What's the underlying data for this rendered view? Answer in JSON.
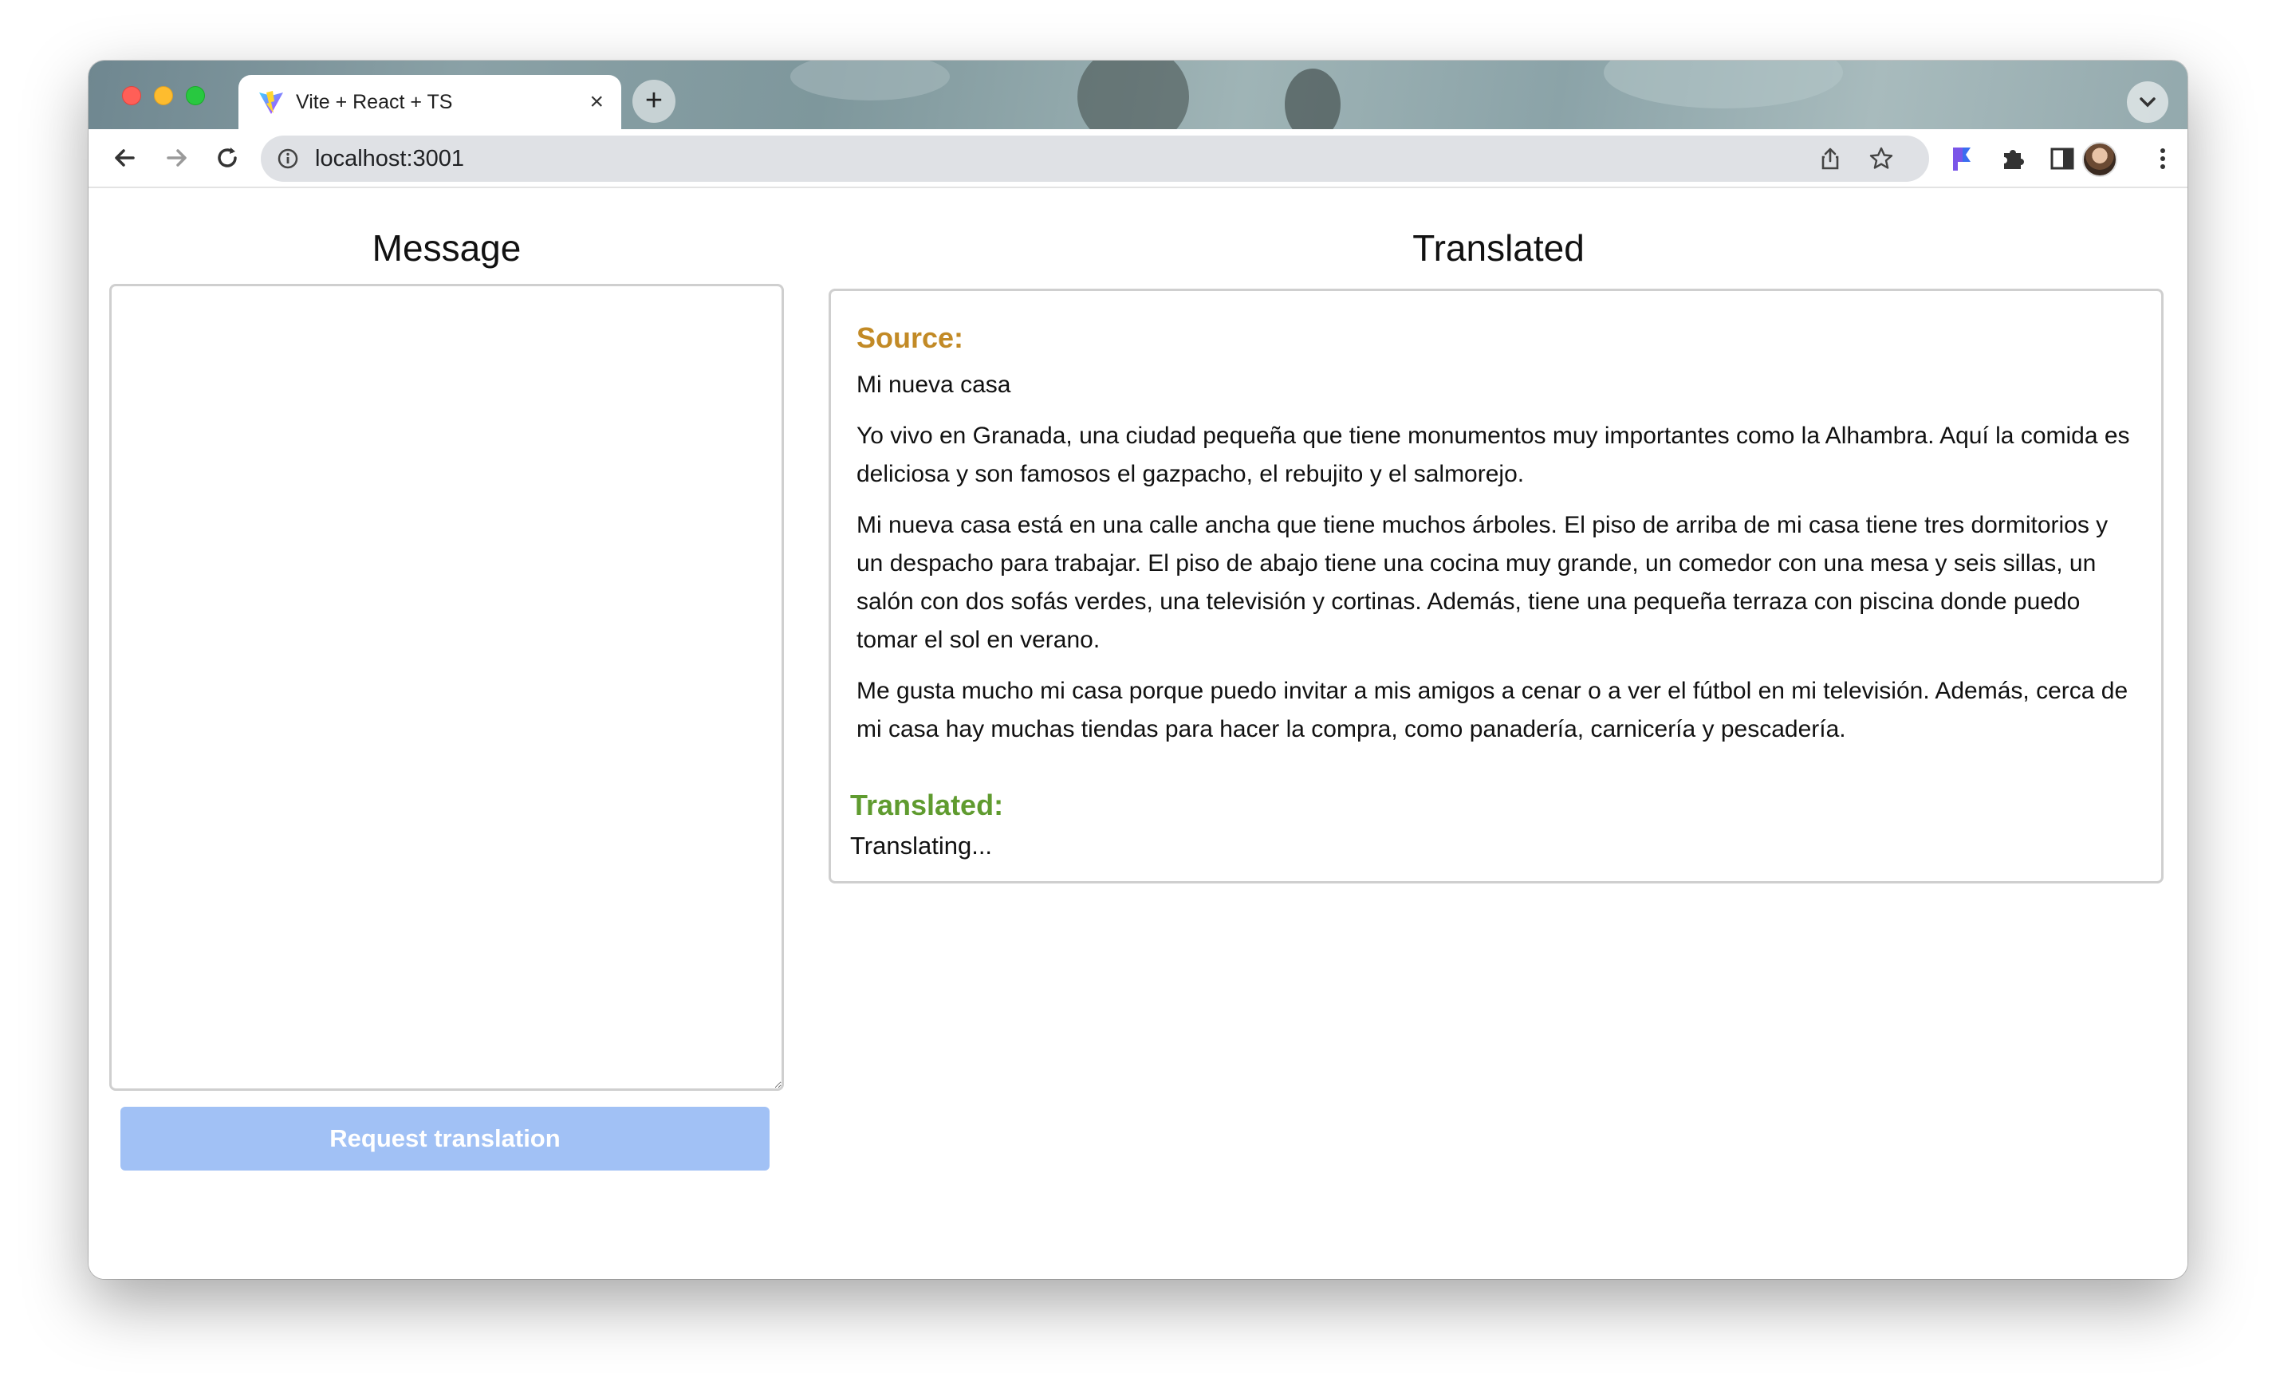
{
  "browser": {
    "tab_title": "Vite + React + TS",
    "tab_close": "×",
    "new_tab": "+",
    "url": "localhost:3001"
  },
  "page": {
    "message_heading": "Message",
    "message_value": "",
    "request_button": "Request translation",
    "translated_heading": "Translated",
    "source_label": "Source:",
    "source_title": "Mi nueva casa",
    "source_paragraphs": [
      "Yo vivo en Granada, una ciudad pequeña que tiene monumentos muy importantes como la Alhambra. Aquí la comida es deliciosa y son famosos el gazpacho, el rebujito y el salmorejo.",
      "Mi nueva casa está en una calle ancha que tiene muchos árboles. El piso de arriba de mi casa tiene tres dormitorios y un despacho para trabajar. El piso de abajo tiene una cocina muy grande, un comedor con una mesa y seis sillas, un salón con dos sofás verdes, una televisión y cortinas. Además, tiene una pequeña terraza con piscina donde puedo tomar el sol en verano.",
      "Me gusta mucho mi casa porque puedo invitar a mis amigos a cenar o a ver el fútbol en mi televisión. Además, cerca de mi casa hay muchas tiendas para hacer la compra, como panadería, carnicería y pescadería."
    ],
    "translated_label": "Translated:",
    "translated_status": "Translating..."
  },
  "colors": {
    "source_label": "#c28a26",
    "translated_label": "#5f9b2f",
    "button_disabled": "#a1c1f5"
  }
}
